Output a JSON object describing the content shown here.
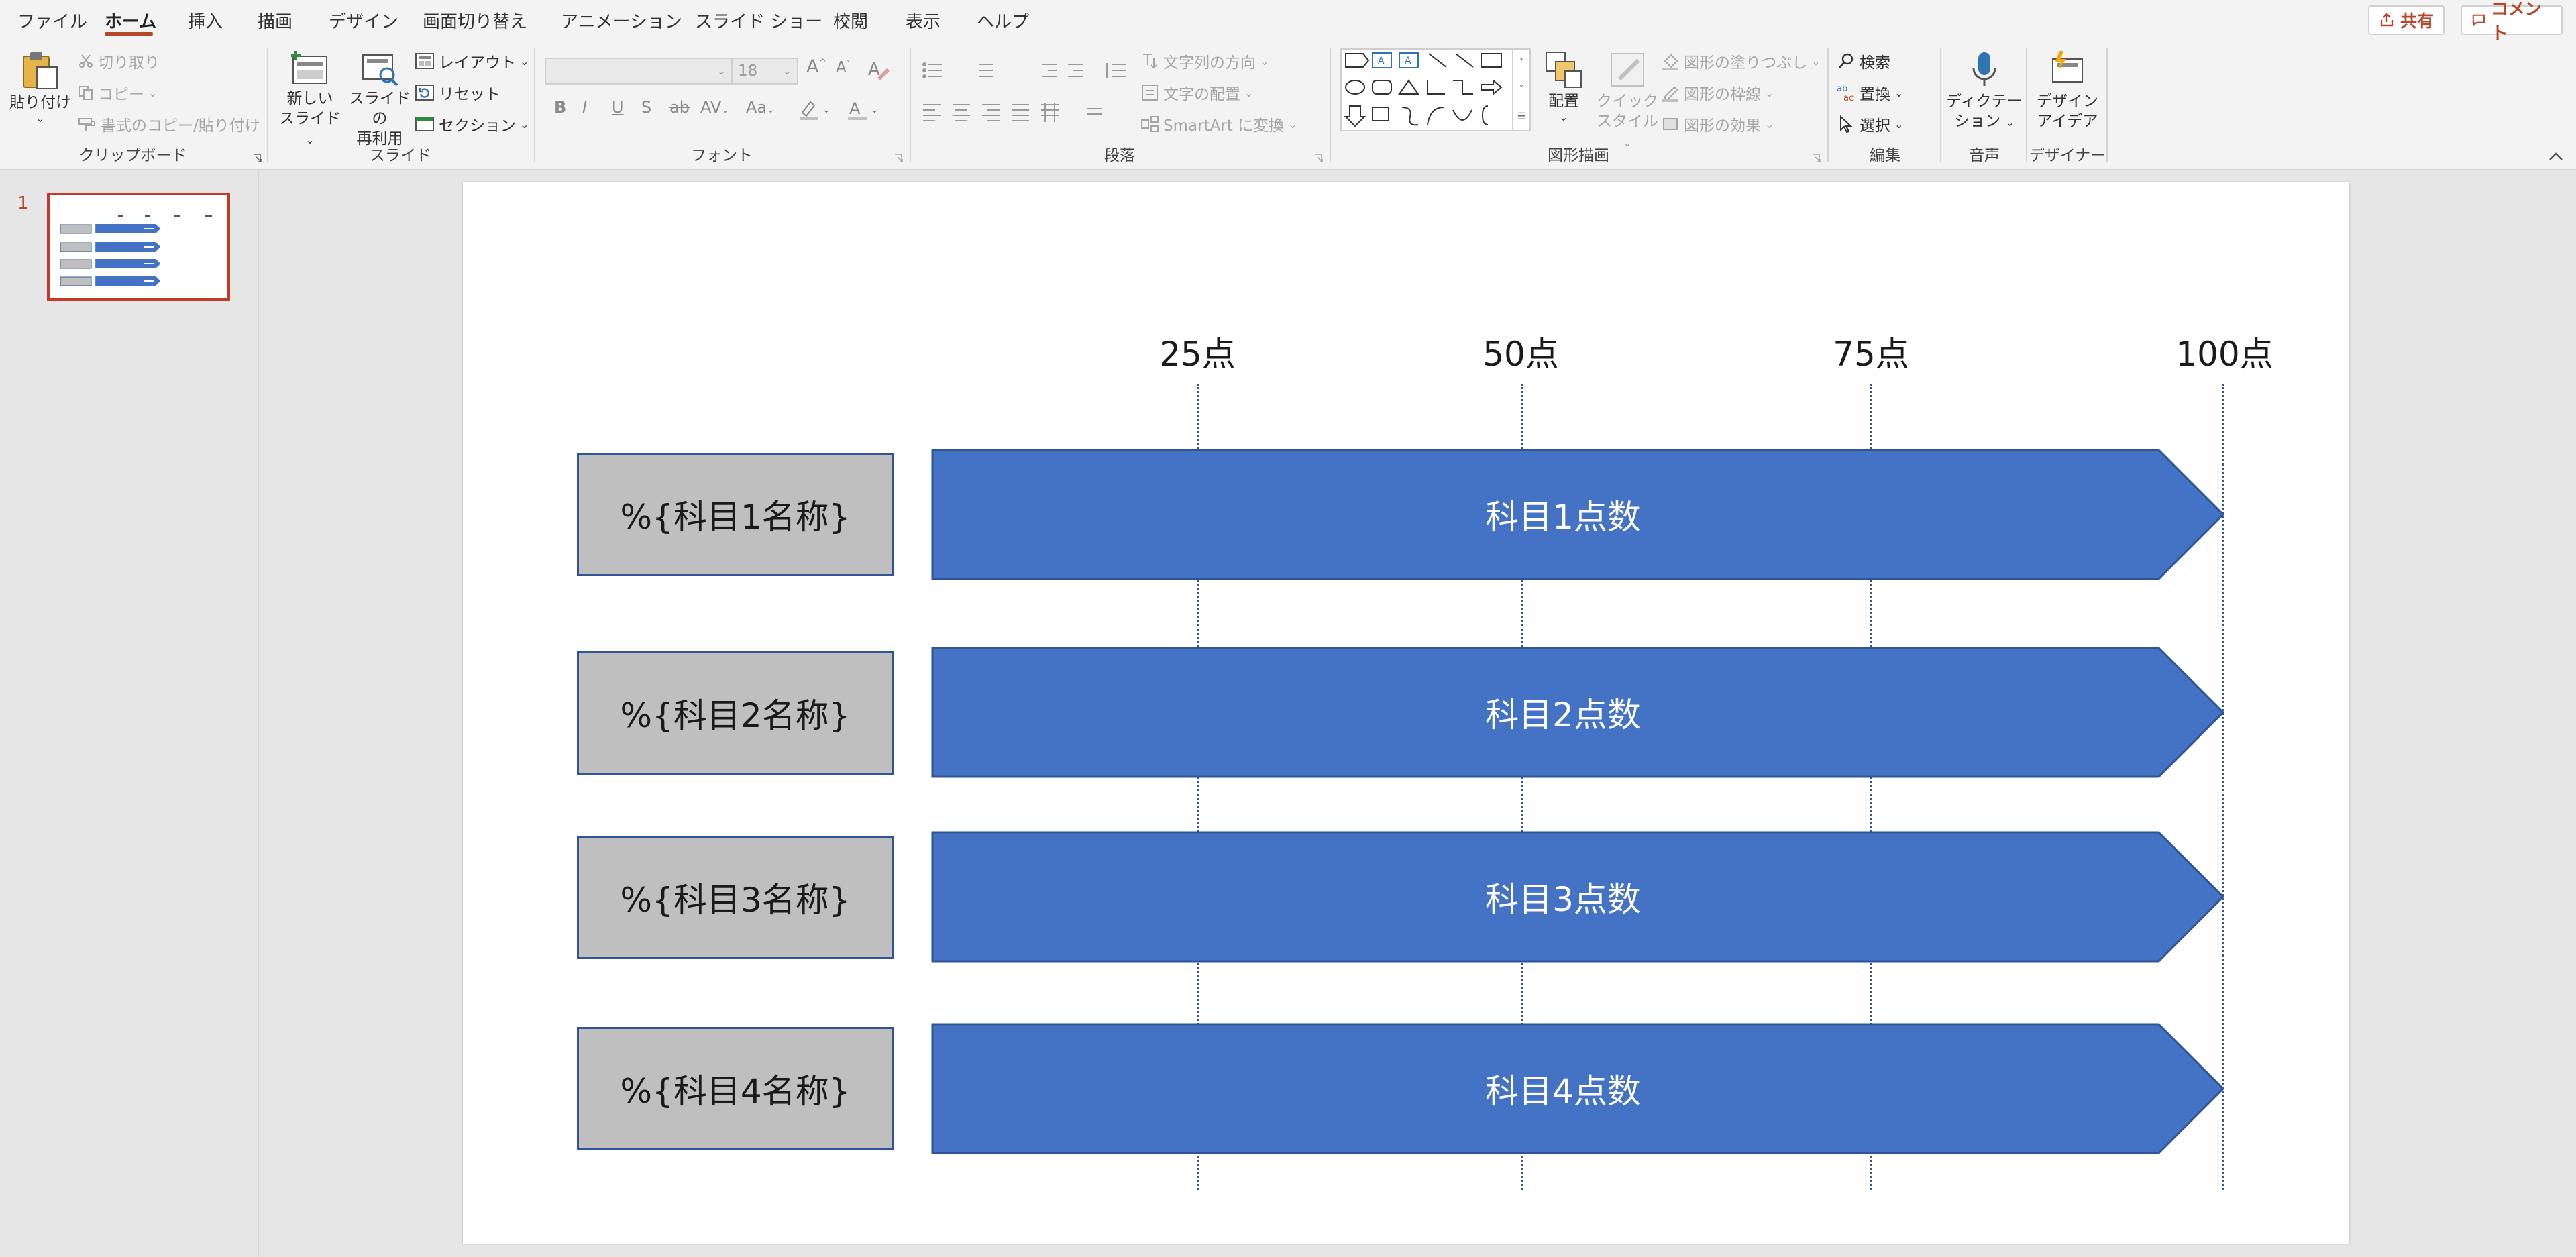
{
  "menu": {
    "tabs": [
      "ファイル",
      "ホーム",
      "挿入",
      "描画",
      "デザイン",
      "画面切り替え",
      "アニメーション",
      "スライド ショー",
      "校閲",
      "表示",
      "ヘルプ"
    ],
    "active_tab": "ホーム",
    "share_label": "共有",
    "comment_label": "コメント"
  },
  "ribbon": {
    "clipboard": {
      "label": "クリップボード",
      "paste": "貼り付け",
      "cut": "切り取り",
      "copy": "コピー",
      "format_painter": "書式のコピー/貼り付け"
    },
    "slides": {
      "label": "スライド",
      "new_slide_1": "新しい",
      "new_slide_2": "スライド",
      "reuse_1": "スライドの",
      "reuse_2": "再利用",
      "layout": "レイアウト",
      "reset": "リセット",
      "section": "セクション"
    },
    "font": {
      "label": "フォント",
      "size": "18"
    },
    "paragraph": {
      "label": "段落",
      "text_direction": "文字列の方向",
      "align_text": "文字の配置",
      "smartart": "SmartArt に変換"
    },
    "drawing": {
      "label": "図形描画",
      "arrange": "配置",
      "quick_style_1": "クイック",
      "quick_style_2": "スタイル",
      "shape_fill": "図形の塗りつぶし",
      "shape_outline": "図形の枠線",
      "shape_effects": "図形の効果"
    },
    "editing": {
      "label": "編集",
      "find": "検索",
      "replace": "置換",
      "select": "選択"
    },
    "voice": {
      "label": "音声",
      "dictate_1": "ディクテー",
      "dictate_2": "ション"
    },
    "designer": {
      "label": "デザイナー",
      "ideas_1": "デザイン",
      "ideas_2": "アイデア"
    }
  },
  "thumbnails": [
    {
      "number": "1"
    }
  ],
  "slide": {
    "ticks": [
      "25点",
      "50点",
      "75点",
      "100点"
    ],
    "rows": [
      {
        "name": "%{科目1名称}",
        "score": "科目1点数"
      },
      {
        "name": "%{科目2名称}",
        "score": "科目2点数"
      },
      {
        "name": "%{科目3名称}",
        "score": "科目3点数"
      },
      {
        "name": "%{科目4名称}",
        "score": "科目4点数"
      }
    ]
  },
  "colors": {
    "accent": "#b7472a",
    "arrow_fill": "#4472c4",
    "arrow_border": "#2f5597",
    "name_box_fill": "#bfbfbf"
  }
}
